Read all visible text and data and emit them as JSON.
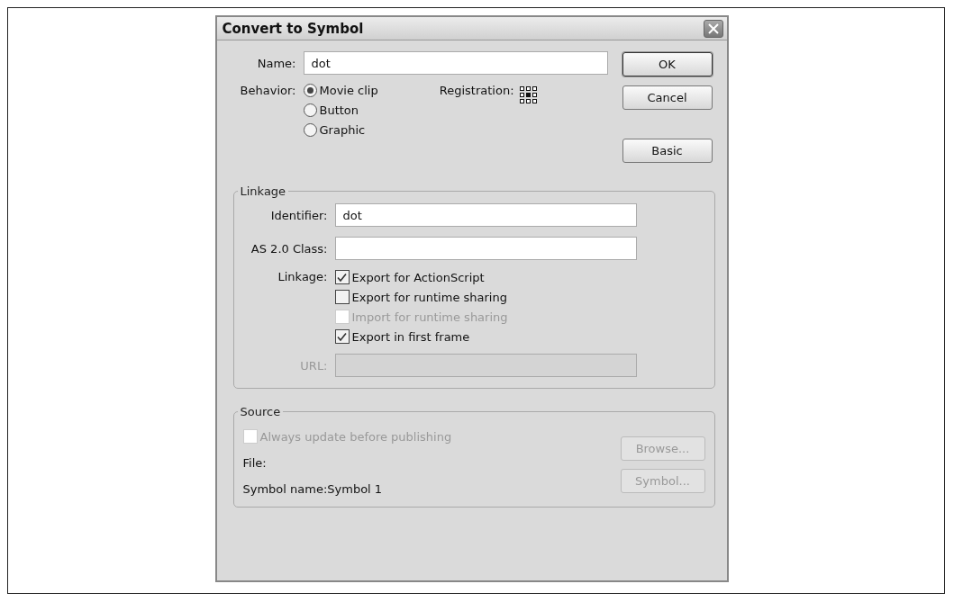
{
  "window": {
    "title": "Convert to Symbol"
  },
  "name_field": {
    "label": "Name:",
    "value": "dot"
  },
  "behavior": {
    "label": "Behavior:",
    "options": [
      {
        "label": "Movie clip",
        "selected": true
      },
      {
        "label": "Button",
        "selected": false
      },
      {
        "label": "Graphic",
        "selected": false
      }
    ]
  },
  "registration": {
    "label": "Registration:",
    "points": [
      {
        "selected": false
      },
      {
        "selected": false
      },
      {
        "selected": false
      },
      {
        "selected": false
      },
      {
        "selected": true
      },
      {
        "selected": false
      },
      {
        "selected": false
      },
      {
        "selected": false
      },
      {
        "selected": false
      }
    ]
  },
  "buttons": [
    {
      "label": "OK",
      "kind": "default"
    },
    {
      "label": "Cancel",
      "kind": "normal"
    },
    {
      "label": "Basic",
      "kind": "spaced"
    }
  ],
  "linkage_group": {
    "title": "Linkage",
    "identifier": {
      "label": "Identifier:",
      "value": "dot"
    },
    "class": {
      "label": "AS 2.0 Class:"
    },
    "linkage_label": "Linkage:",
    "options": [
      {
        "label": "Export for ActionScript",
        "checked": true,
        "disabled": false
      },
      {
        "label": "Export for runtime sharing",
        "checked": false,
        "disabled": false
      },
      {
        "label": "Import for runtime sharing",
        "checked": false,
        "disabled": true
      },
      {
        "label": "Export in first frame",
        "checked": true,
        "disabled": false
      }
    ],
    "url": {
      "label": "URL:",
      "disabled": true
    }
  },
  "source_group": {
    "title": "Source",
    "always_update": {
      "label": "Always update before publishing",
      "checked": false,
      "disabled": true
    },
    "file_label": "File:",
    "symbol_name": "Symbol name:Symbol 1",
    "buttons": [
      {
        "label": "Browse...",
        "disabled": true
      },
      {
        "label": "Symbol...",
        "disabled": true
      }
    ]
  }
}
